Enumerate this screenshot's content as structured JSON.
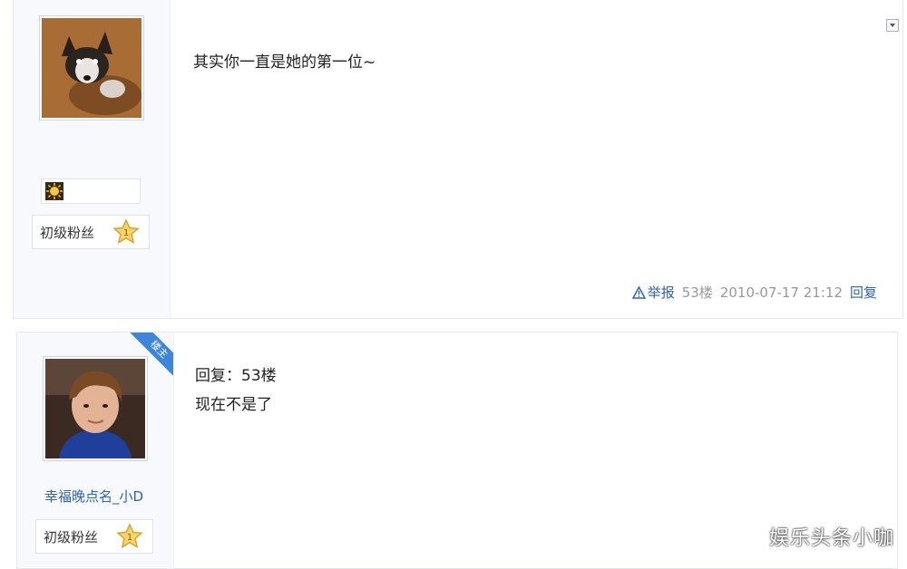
{
  "posts": [
    {
      "content": "其实你一直是她的第一位~",
      "level": "初级粉丝",
      "level_star": "1",
      "footer": {
        "report": "举报",
        "floor": "53楼",
        "timestamp": "2010-07-17 21:12",
        "reply": "回复"
      }
    },
    {
      "ribbon": "楼主",
      "content_line1": "回复：53楼",
      "content_line2": "现在不是了",
      "username": "幸福晚点名_小D",
      "level": "初级粉丝",
      "level_star": "1"
    }
  ],
  "watermark": "娱乐头条小咖"
}
